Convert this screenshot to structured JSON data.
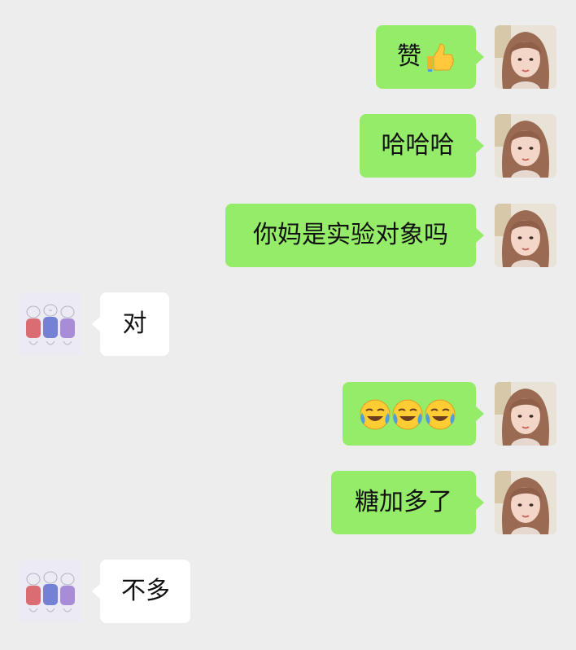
{
  "chat": {
    "messages": [
      {
        "sender": "me",
        "text": "赞",
        "emoji": "thumbs-up"
      },
      {
        "sender": "me",
        "text": "哈哈哈"
      },
      {
        "sender": "me",
        "text": "你妈是实验对象吗"
      },
      {
        "sender": "other",
        "text": "对"
      },
      {
        "sender": "me",
        "text": "",
        "emoji": "crying-laughing x3"
      },
      {
        "sender": "me",
        "text": "糖加多了"
      },
      {
        "sender": "other",
        "text": "不多"
      }
    ]
  },
  "colors": {
    "background": "#ededed",
    "my_bubble": "#95ec69",
    "their_bubble": "#ffffff"
  }
}
